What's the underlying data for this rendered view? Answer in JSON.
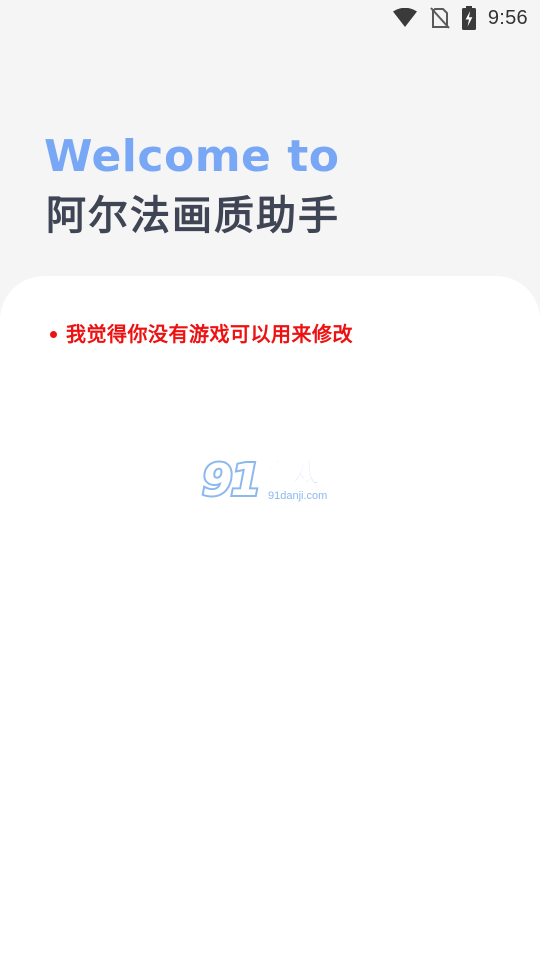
{
  "status_bar": {
    "time": "9:56",
    "icons": [
      "wifi-icon",
      "no-sim-icon",
      "battery-charging-icon"
    ]
  },
  "header": {
    "welcome": "Welcome to",
    "app_name": "阿尔法画质助手"
  },
  "notice": {
    "text": "我觉得你没有游戏可以用来修改"
  },
  "watermark": {
    "logo_number": "91",
    "logo_text": "游戏",
    "logo_domain": "91danji.com"
  },
  "colors": {
    "background": "#f5f5f5",
    "card": "#ffffff",
    "welcome": "#78a8f5",
    "app_name": "#3f4554",
    "notice": "#ee1111",
    "watermark": "#8cb8ee"
  }
}
